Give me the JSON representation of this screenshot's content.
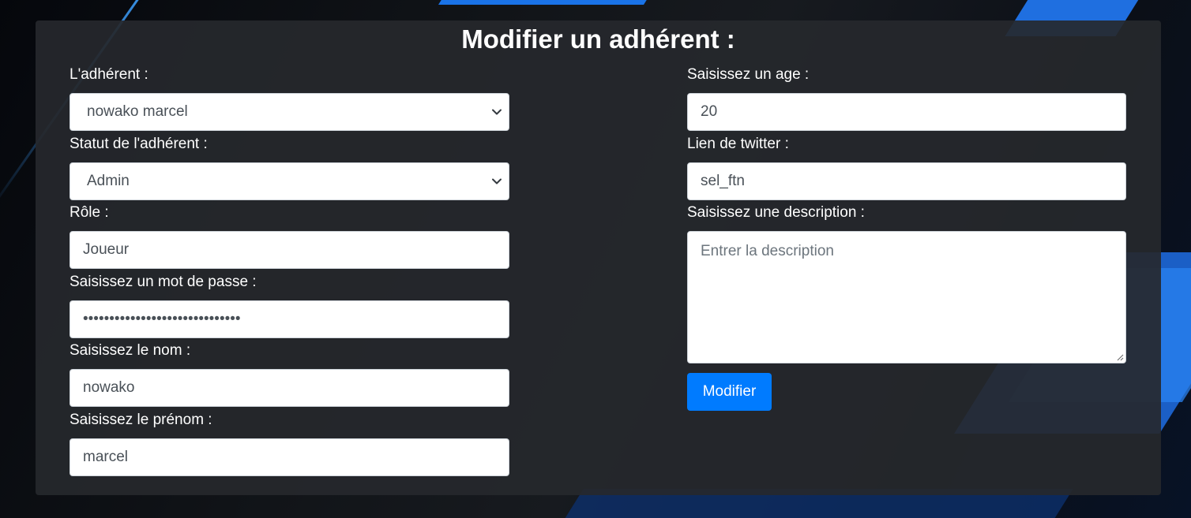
{
  "form": {
    "title": "Modifier un adhérent :",
    "member_label": "L'adhérent :",
    "member_value": "nowako marcel",
    "status_label": "Statut de l'adhérent :",
    "status_value": "Admin",
    "role_label": "Rôle :",
    "role_value": "Joueur",
    "password_label": "Saisissez un mot de passe :",
    "password_value": "••••••••••••••••••••••••••••••",
    "lastname_label": "Saisissez le nom :",
    "lastname_value": "nowako",
    "firstname_label": "Saisissez le prénom :",
    "firstname_value": "marcel",
    "age_label": "Saisissez un age :",
    "age_value": "20",
    "twitter_label": "Lien de twitter :",
    "twitter_value": "sel_ftn",
    "description_label": "Saisissez une description :",
    "description_placeholder": "Entrer la description",
    "submit_label": "Modifier"
  },
  "icons": {
    "select_arrow": "chevron-down-icon",
    "textarea_resize": "resize-grip-icon"
  },
  "colors": {
    "primary_button": "#007bff",
    "panel_background": "#26282c",
    "accent_blue": "#1a73e8"
  }
}
